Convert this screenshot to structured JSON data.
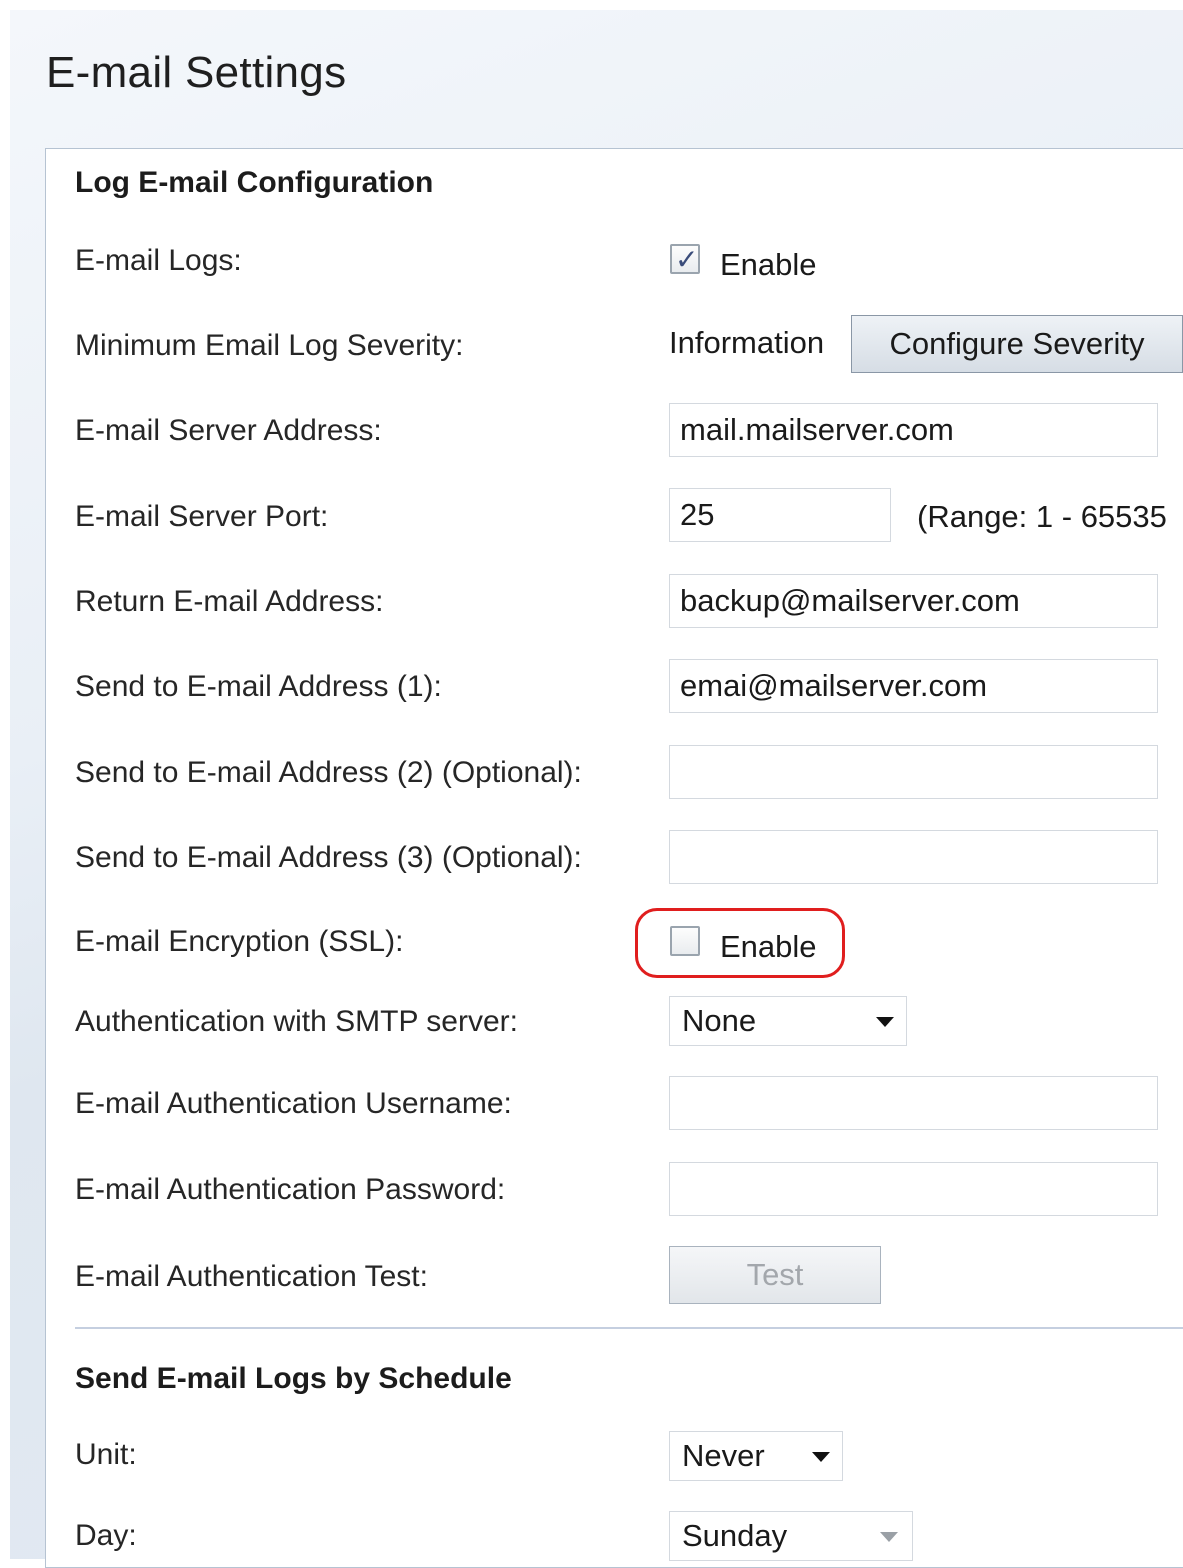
{
  "page": {
    "title": "E-mail Settings"
  },
  "log_config": {
    "heading": "Log E-mail Configuration",
    "email_logs": {
      "label": "E-mail Logs:",
      "checked": true,
      "option_label": "Enable"
    },
    "min_severity": {
      "label": "Minimum Email Log Severity:",
      "value": "Information",
      "button_label": "Configure Severity"
    },
    "server_address": {
      "label": "E-mail Server Address:",
      "value": "mail.mailserver.com"
    },
    "server_port": {
      "label": "E-mail Server Port:",
      "value": "25",
      "range_hint": "(Range: 1 - 65535"
    },
    "return_address": {
      "label": "Return E-mail Address:",
      "value": "backup@mailserver.com"
    },
    "send_to_1": {
      "label": "Send to E-mail Address (1):",
      "value": "emai@mailserver.com"
    },
    "send_to_2": {
      "label": "Send to E-mail Address (2) (Optional):",
      "value": ""
    },
    "send_to_3": {
      "label": "Send to E-mail Address (3) (Optional):",
      "value": ""
    },
    "encryption": {
      "label": "E-mail Encryption (SSL):",
      "checked": false,
      "option_label": "Enable",
      "highlight_color": "#e01e1e"
    },
    "smtp_auth": {
      "label": "Authentication with SMTP server:",
      "value": "None"
    },
    "auth_username": {
      "label": "E-mail Authentication Username:",
      "value": ""
    },
    "auth_password": {
      "label": "E-mail Authentication Password:",
      "value": ""
    },
    "auth_test": {
      "label": "E-mail Authentication Test:",
      "button_label": "Test",
      "disabled": true
    }
  },
  "schedule": {
    "heading": "Send E-mail Logs by Schedule",
    "unit": {
      "label": "Unit:",
      "value": "Never"
    },
    "day": {
      "label": "Day:",
      "value": "Sunday",
      "disabled": true
    }
  }
}
